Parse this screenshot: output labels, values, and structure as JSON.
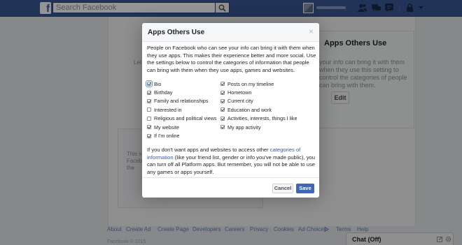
{
  "topbar": {
    "logo": "f",
    "search_placeholder": "Search Facebook",
    "icons": [
      "search-icon",
      "friend-requests-icon",
      "messages-icon",
      "notifications-icon",
      "lock-icon",
      "chevron-down-icon"
    ]
  },
  "background": {
    "right_panel_title": "Apps Others Use",
    "right_panel_text": "your info can bring it with them when they use this setting to control the categories of people can bring with them.",
    "edit_button": "Edit",
    "frag_let": "Let",
    "frag_this": "This se",
    "frag_fb": "Facebo",
    "frag_the": "the"
  },
  "dialog": {
    "title": "Apps Others Use",
    "close": "×",
    "intro": "People on Facebook who can see your info can bring it with them when they use apps. This makes their experience better and more social. Use the settings below to control the categories of information that people can bring with them when they use apps, games and websites.",
    "left_options": [
      {
        "label": "Bio",
        "checked": true
      },
      {
        "label": "Birthday",
        "checked": true
      },
      {
        "label": "Family and relationships",
        "checked": true
      },
      {
        "label": "Interested in",
        "checked": false
      },
      {
        "label": "Religious and political views",
        "checked": false
      },
      {
        "label": "My website",
        "checked": true
      },
      {
        "label": "If I'm online",
        "checked": true
      }
    ],
    "right_options": [
      {
        "label": "Posts on my timeline",
        "checked": true
      },
      {
        "label": "Hometown",
        "checked": true
      },
      {
        "label": "Current city",
        "checked": true
      },
      {
        "label": "Education and work",
        "checked": true
      },
      {
        "label": "Activities, interests, things I like",
        "checked": true
      },
      {
        "label": "My app activity",
        "checked": true
      }
    ],
    "bottom_text_before": "If you don't want apps and websites to access other ",
    "bottom_link": "categories of information",
    "bottom_text_after": " (like your friend list, gender or info you've made public), you can turn off all Platform apps. But remember, you will not be able to use any games or apps yourself.",
    "cancel_label": "Cancel",
    "save_label": "Save"
  },
  "footer": {
    "links": [
      "About",
      "Create Ad",
      "Create Page",
      "Developers",
      "Careers",
      "Privacy",
      "Cookies",
      "Ad Choices",
      "Terms",
      "Help"
    ],
    "copyright": "Facebook © 2015"
  },
  "chat": {
    "label": "Chat (Off)"
  },
  "colors": {
    "brand": "#3b5998",
    "primary_button": "#4267b2",
    "link": "#365899"
  }
}
